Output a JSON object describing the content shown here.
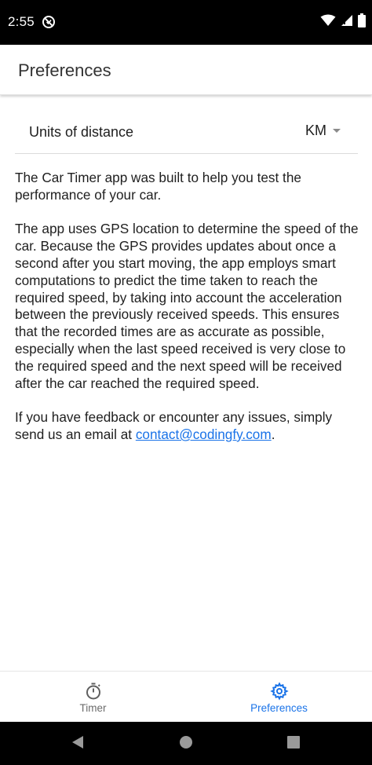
{
  "status_bar": {
    "time": "2:55",
    "app_icon": "do-not-disturb-icon",
    "icons": [
      "wifi-icon",
      "signal-icon",
      "battery-icon"
    ]
  },
  "app_bar": {
    "title": "Preferences"
  },
  "settings": {
    "units_label": "Units of distance",
    "units_value": "KM",
    "units_options_visible": [
      "KM"
    ]
  },
  "content": {
    "paragraph_1": "The Car Timer app was built to help you test the performance of your car.",
    "paragraph_2": "The app uses GPS location to determine the speed of the car. Because the GPS provides updates about once a second after you start moving, the app employs smart computations to predict the time taken to reach the required speed, by taking into account the acceleration between the previously received speeds. This ensures that the recorded times are as accurate as possible, especially when the last speed received is very close to the required speed and the next speed will be received after the car reached the required speed.",
    "paragraph_3_prefix": "If you have feedback or encounter any issues, simply send us an email at ",
    "email": "contact@codingfy.com",
    "paragraph_3_suffix": "."
  },
  "bottom_nav": {
    "items": [
      {
        "label": "Timer",
        "icon": "stopwatch-icon",
        "active": false
      },
      {
        "label": "Preferences",
        "icon": "gear-icon",
        "active": true
      }
    ]
  },
  "system_nav": {
    "buttons": [
      "back-icon",
      "home-icon",
      "recents-icon"
    ]
  },
  "colors": {
    "accent": "#1a73e8",
    "status_bar": "#000000",
    "text": "#1f1f1f",
    "inactive": "#6b6b6b"
  }
}
